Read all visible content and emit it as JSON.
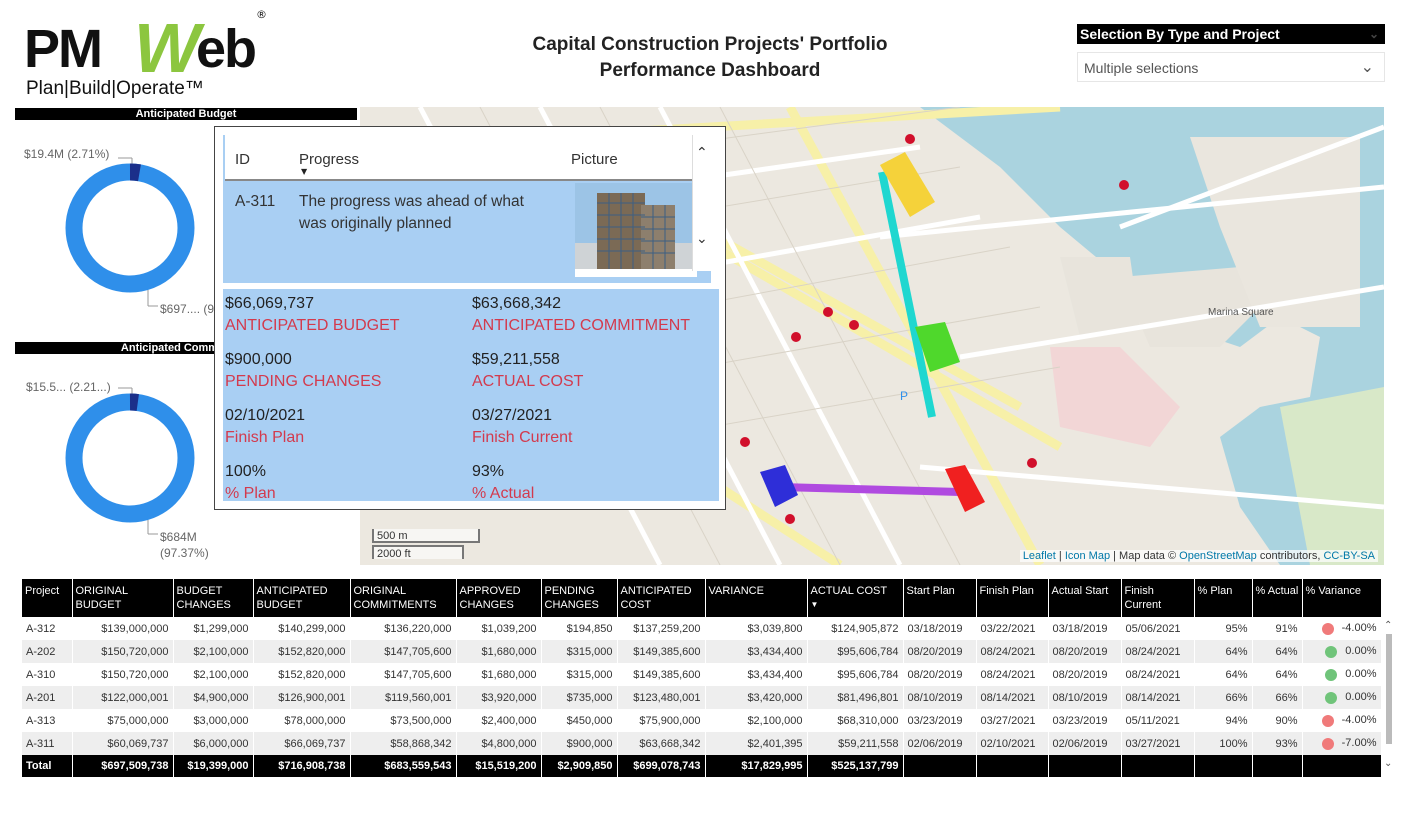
{
  "logo": {
    "part1": "PM",
    "part2": "W",
    "part3": "eb",
    "reg": "®",
    "tagline": "Plan|Build|Operate™"
  },
  "title": {
    "line1": "Capital Construction Projects' Portfolio",
    "line2": "Performance Dashboard"
  },
  "slicer": {
    "title": "Selection By Type and Project",
    "value": "Multiple selections"
  },
  "budget_panel": {
    "title": "Anticipated Budget",
    "small_label": "$19.4M (2.71%)",
    "large_label": "$697.... (9"
  },
  "commitment_panel": {
    "title": "Anticipated Commitment",
    "small_label": "$15.5... (2.21...)",
    "large_label_1": "$684M",
    "large_label_2": "(97.37%)"
  },
  "map": {
    "scale_m": "500 m",
    "scale_ft": "2000 ft",
    "attribution": {
      "leaflet": "Leaflet",
      "icon_map": "Icon Map",
      "map_data": " | Map data © ",
      "osm": "OpenStreetMap",
      "contrib": " contributors, ",
      "license": "CC-BY-SA"
    },
    "place_label": "Marina Square"
  },
  "tooltip": {
    "headers": {
      "id": "ID",
      "progress": "Progress",
      "picture": "Picture"
    },
    "row": {
      "id": "A-311",
      "progress_1": "The progress was ahead of what",
      "progress_2": "was originally planned"
    },
    "fields": [
      {
        "value": "$66,069,737",
        "label": "ANTICIPATED BUDGET"
      },
      {
        "value": "$63,668,342",
        "label": "ANTICIPATED COMMITMENT"
      },
      {
        "value": "$900,000",
        "label": "PENDING CHANGES"
      },
      {
        "value": "$59,211,558",
        "label": "ACTUAL COST"
      },
      {
        "value": "02/10/2021",
        "label": "Finish Plan"
      },
      {
        "value": "03/27/2021",
        "label": "Finish Current"
      },
      {
        "value": "100%",
        "label": "% Plan"
      },
      {
        "value": "93%",
        "label": "% Actual"
      }
    ]
  },
  "table": {
    "columns": [
      "Project",
      "ORIGINAL BUDGET",
      "BUDGET CHANGES",
      "ANTICIPATED BUDGET",
      "ORIGINAL COMMITMENTS",
      "APPROVED CHANGES",
      "PENDING CHANGES",
      "ANTICIPATED COST",
      "VARIANCE",
      "ACTUAL COST",
      "Start Plan",
      "Finish Plan",
      "Actual Start",
      "Finish Current",
      "% Plan",
      "% Actual",
      "% Variance"
    ],
    "rows": [
      [
        "A-312",
        "$139,000,000",
        "$1,299,000",
        "$140,299,000",
        "$136,220,000",
        "$1,039,200",
        "$194,850",
        "$137,259,200",
        "$3,039,800",
        "$124,905,872",
        "03/18/2019",
        "03/22/2021",
        "03/18/2019",
        "05/06/2021",
        "95%",
        "91%",
        "-4.00%"
      ],
      [
        "A-202",
        "$150,720,000",
        "$2,100,000",
        "$152,820,000",
        "$147,705,600",
        "$1,680,000",
        "$315,000",
        "$149,385,600",
        "$3,434,400",
        "$95,606,784",
        "08/20/2019",
        "08/24/2021",
        "08/20/2019",
        "08/24/2021",
        "64%",
        "64%",
        "0.00%"
      ],
      [
        "A-310",
        "$150,720,000",
        "$2,100,000",
        "$152,820,000",
        "$147,705,600",
        "$1,680,000",
        "$315,000",
        "$149,385,600",
        "$3,434,400",
        "$95,606,784",
        "08/20/2019",
        "08/24/2021",
        "08/20/2019",
        "08/24/2021",
        "64%",
        "64%",
        "0.00%"
      ],
      [
        "A-201",
        "$122,000,001",
        "$4,900,000",
        "$126,900,001",
        "$119,560,001",
        "$3,920,000",
        "$735,000",
        "$123,480,001",
        "$3,420,000",
        "$81,496,801",
        "08/10/2019",
        "08/14/2021",
        "08/10/2019",
        "08/14/2021",
        "66%",
        "66%",
        "0.00%"
      ],
      [
        "A-313",
        "$75,000,000",
        "$3,000,000",
        "$78,000,000",
        "$73,500,000",
        "$2,400,000",
        "$450,000",
        "$75,900,000",
        "$2,100,000",
        "$68,310,000",
        "03/23/2019",
        "03/27/2021",
        "03/23/2019",
        "05/11/2021",
        "94%",
        "90%",
        "-4.00%"
      ],
      [
        "A-311",
        "$60,069,737",
        "$6,000,000",
        "$66,069,737",
        "$58,868,342",
        "$4,800,000",
        "$900,000",
        "$63,668,342",
        "$2,401,395",
        "$59,211,558",
        "02/06/2019",
        "02/10/2021",
        "02/06/2019",
        "03/27/2021",
        "100%",
        "93%",
        "-7.00%"
      ]
    ],
    "status_colors": [
      "#f07a7a",
      "#70c47a",
      "#70c47a",
      "#70c47a",
      "#f07a7a",
      "#f07a7a"
    ],
    "totals": [
      "Total",
      "$697,509,738",
      "$19,399,000",
      "$716,908,738",
      "$683,559,543",
      "$15,519,200",
      "$2,909,850",
      "$699,078,743",
      "$17,829,995",
      "$525,137,799",
      "",
      "",
      "",
      "",
      "",
      "",
      ""
    ]
  }
}
